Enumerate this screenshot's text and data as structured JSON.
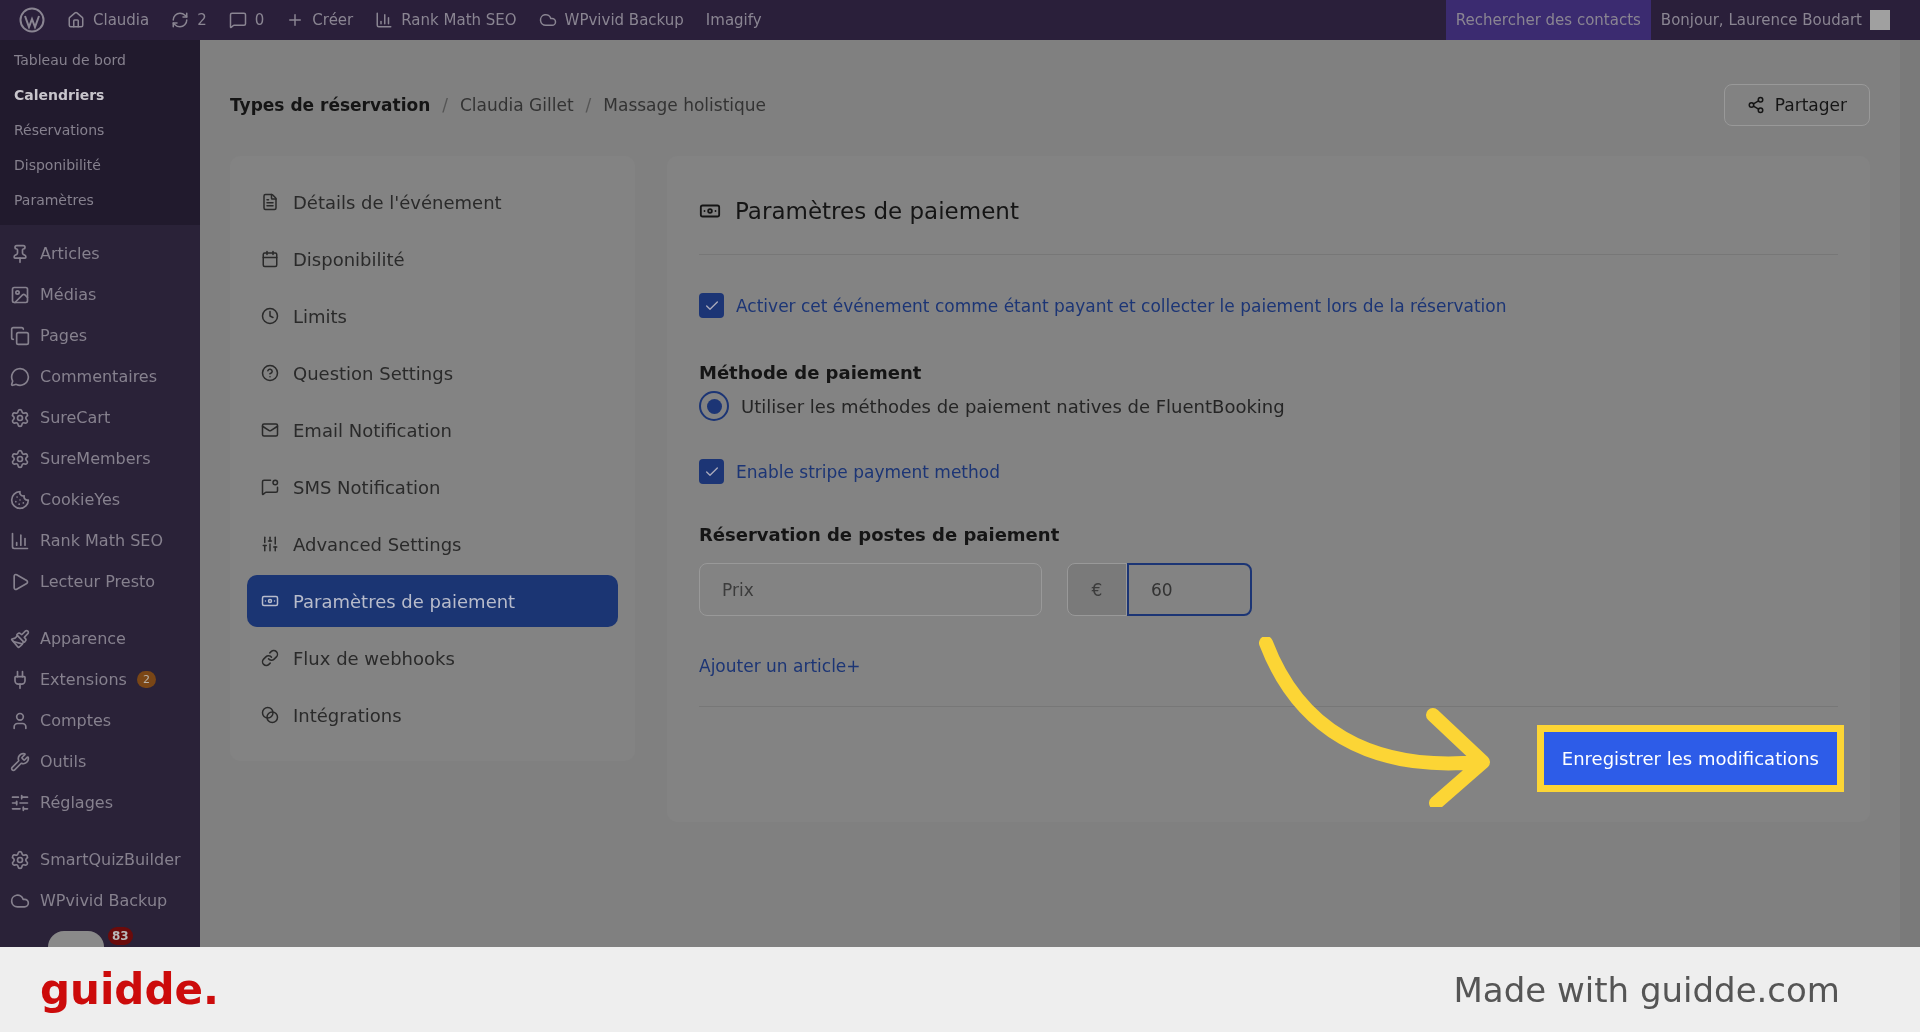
{
  "admin_bar": {
    "items": [
      {
        "kind": "logo"
      },
      {
        "kind": "site",
        "label": "Claudia"
      },
      {
        "kind": "updates",
        "label": "2"
      },
      {
        "kind": "comments",
        "label": "0"
      },
      {
        "kind": "new",
        "label": "Créer"
      },
      {
        "kind": "rankmath",
        "label": "Rank Math SEO"
      },
      {
        "kind": "cloud",
        "label": "WPvivid Backup"
      },
      {
        "kind": "text",
        "label": "Imagify"
      }
    ],
    "search": "Rechercher des contacts",
    "greeting": "Bonjour, Laurence Boudart"
  },
  "sidebar": {
    "submenu": [
      {
        "label": "Tableau de bord",
        "selected": false
      },
      {
        "label": "Calendriers",
        "selected": true
      },
      {
        "label": "Réservations",
        "selected": false
      },
      {
        "label": "Disponibilité",
        "selected": false
      },
      {
        "label": "Paramètres",
        "selected": false
      }
    ],
    "groups": [
      [
        {
          "kind": "pin",
          "label": "Articles"
        },
        {
          "kind": "media",
          "label": "Médias"
        },
        {
          "kind": "pages",
          "label": "Pages"
        },
        {
          "kind": "comment",
          "label": "Commentaires"
        },
        {
          "kind": "sure",
          "label": "SureCart"
        },
        {
          "kind": "sure",
          "label": "SureMembers"
        },
        {
          "kind": "cookie",
          "label": "CookieYes"
        },
        {
          "kind": "rankmath",
          "label": "Rank Math SEO"
        },
        {
          "kind": "presto",
          "label": "Lecteur Presto"
        }
      ],
      [
        {
          "kind": "brush",
          "label": "Apparence"
        },
        {
          "kind": "plug",
          "label": "Extensions",
          "badge": "2"
        },
        {
          "kind": "user",
          "label": "Comptes"
        },
        {
          "kind": "wrench",
          "label": "Outils"
        },
        {
          "kind": "sliders",
          "label": "Réglages"
        }
      ],
      [
        {
          "kind": "gear",
          "label": "SmartQuizBuilder"
        },
        {
          "kind": "cloud",
          "label": "WPvivid Backup"
        }
      ]
    ],
    "chat_badge": "83"
  },
  "breadcrumb": [
    "Types de réservation",
    "Claudia Gillet",
    "Massage holistique"
  ],
  "breadcrumb_separator": "/",
  "share_button": "Partager",
  "settings_nav": [
    {
      "kind": "details",
      "label": "Détails de l'événement",
      "selected": false
    },
    {
      "kind": "calendar",
      "label": "Disponibilité",
      "selected": false
    },
    {
      "kind": "clock",
      "label": "Limits",
      "selected": false
    },
    {
      "kind": "question",
      "label": "Question Settings",
      "selected": false
    },
    {
      "kind": "mail",
      "label": "Email Notification",
      "selected": false
    },
    {
      "kind": "sms",
      "label": "SMS Notification",
      "selected": false
    },
    {
      "kind": "sliders",
      "label": "Advanced Settings",
      "selected": false
    },
    {
      "kind": "payment",
      "label": "Paramètres de paiement",
      "selected": true
    },
    {
      "kind": "link",
      "label": "Flux de webhooks",
      "selected": false
    },
    {
      "kind": "integrations",
      "label": "Intégrations",
      "selected": false
    }
  ],
  "panel": {
    "title": "Paramètres de paiement",
    "enable_paid": {
      "label": "Activer cet événement comme étant payant et collecter le paiement lors de la réservation",
      "checked": true
    },
    "method_heading": "Méthode de paiement",
    "method_option": {
      "label": "Utiliser les méthodes de paiement natives de FluentBooking",
      "selected": true
    },
    "stripe": {
      "label": "Enable stripe payment method",
      "checked": true
    },
    "items_heading": "Réservation de postes de paiement",
    "item": {
      "name_placeholder": "Prix",
      "currency": "€",
      "price": "60"
    },
    "add_item": "Ajouter un article+",
    "save_button": "Enregistrer les modifications"
  },
  "footer": {
    "brand": "guidde.",
    "credit": "Made with guidde.com"
  }
}
